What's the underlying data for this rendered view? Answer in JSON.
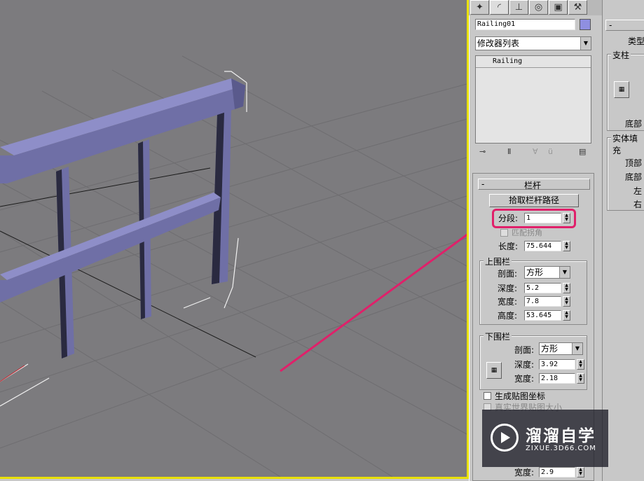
{
  "command_panel": {
    "tabs": [
      {
        "icon": "create-icon"
      },
      {
        "icon": "modify-icon"
      },
      {
        "icon": "hierarchy-icon"
      },
      {
        "icon": "motion-icon"
      },
      {
        "icon": "display-icon"
      },
      {
        "icon": "utilities-icon"
      }
    ],
    "object_name": "Railing01",
    "object_color": "#8f8fe0",
    "modifier_list": "修改器列表",
    "stack_item": "Railing"
  },
  "railing_rollout": {
    "title": "栏杆",
    "collapse": "-",
    "pick_path_button": "拾取栏杆路径",
    "segments_label": "分段:",
    "segments_value": "1",
    "respect_corners_label": "匹配拐角",
    "length_label": "长度:",
    "length_value": "75.644",
    "top_rail": {
      "title": "上围栏",
      "profile_label": "剖面:",
      "profile_value": "方形",
      "depth_label": "深度:",
      "depth_value": "5.2",
      "width_label": "宽度:",
      "width_value": "7.8",
      "height_label": "高度:",
      "height_value": "53.645"
    },
    "lower_rail": {
      "title": "下围栏",
      "profile_label": "剖面:",
      "profile_value": "方形",
      "depth_label": "深度:",
      "depth_value": "3.92",
      "width_label": "宽度:",
      "width_value": "2.18"
    },
    "gen_mapping_label": "生成贴图坐标",
    "real_world_label": "真实世界贴图大小",
    "bottom_width_label": "宽度:",
    "bottom_width_value": "2.9"
  },
  "right_panel": {
    "collapse": "-",
    "type_label": "类型",
    "posts_label": "支柱",
    "bottom_label": "底部",
    "solid_fill_label": "实体填充",
    "top_label": "顶部",
    "bottom2_label": "底部",
    "left_label": "左",
    "right_label": "右"
  },
  "watermark": {
    "title": "溜溜自学",
    "url": "ZIXUE.3D66.COM"
  },
  "colors": {
    "viewport_bg": "#7c7b7e",
    "railing_fill": "#6f6fa6",
    "highlight": "#e0206a",
    "viewport_border": "#e8e000"
  }
}
